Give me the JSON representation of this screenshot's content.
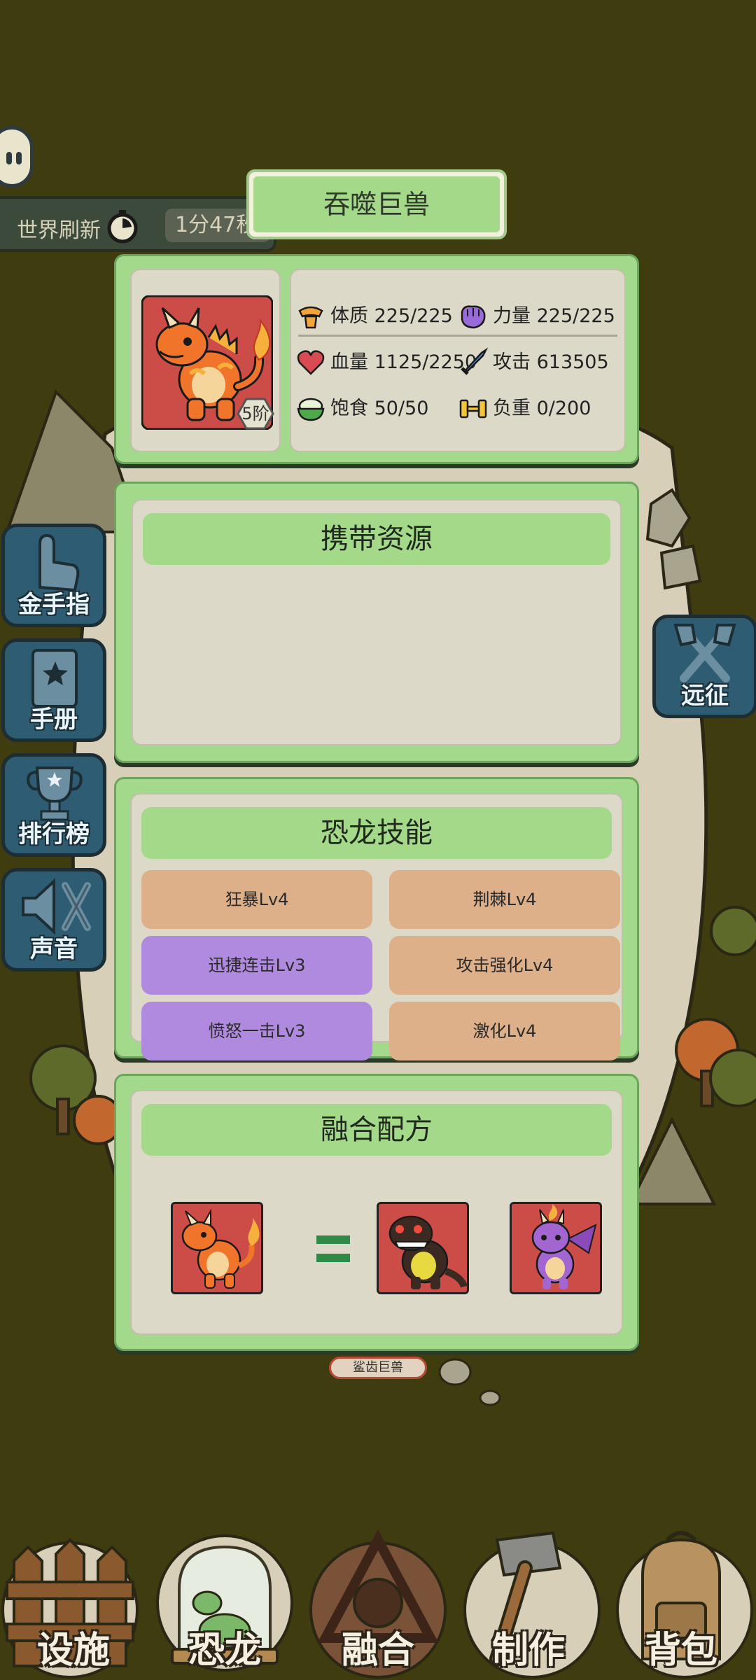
{
  "world": {
    "label": "世界刷新",
    "timer": "1分47秒"
  },
  "creature": {
    "title": "吞噬巨兽",
    "rank": "5阶",
    "stats": {
      "constitution": {
        "label": "体质",
        "value": "225/225"
      },
      "strength": {
        "label": "力量",
        "value": "225/225"
      },
      "hp": {
        "label": "血量",
        "value": "1125/2250"
      },
      "attack": {
        "label": "攻击",
        "value": "613505"
      },
      "satiety": {
        "label": "饱食",
        "value": "50/50"
      },
      "load": {
        "label": "负重",
        "value": "0/200"
      }
    }
  },
  "resources": {
    "header": "携带资源"
  },
  "skills": {
    "header": "恐龙技能",
    "items": [
      {
        "label": "狂暴Lv4",
        "color": "#ddb08a"
      },
      {
        "label": "荆棘Lv4",
        "color": "#ddb08a"
      },
      {
        "label": "迅捷连击Lv3",
        "color": "#b08ade"
      },
      {
        "label": "攻击强化Lv4",
        "color": "#ddb08a"
      },
      {
        "label": "愤怒一击Lv3",
        "color": "#b08ade"
      },
      {
        "label": "激化Lv4",
        "color": "#ddb08a"
      }
    ]
  },
  "recipe": {
    "header": "融合配方"
  },
  "map_tag": "鲨齿巨兽",
  "side_buttons": {
    "golden_finger": "金手指",
    "manual": "手册",
    "leaderboard": "排行榜",
    "sound": "声音",
    "expedition": "远征"
  },
  "bottom_nav": {
    "facilities": "设施",
    "dinosaur": "恐龙",
    "fusion": "融合",
    "craft": "制作",
    "backpack": "背包"
  },
  "colors": {
    "panel_green": "#a2d98a",
    "panel_body": "#dcd9c9",
    "skill_orange": "#ddb08a",
    "skill_purple": "#b08ade",
    "side_button_blue": "#2e5d73"
  }
}
